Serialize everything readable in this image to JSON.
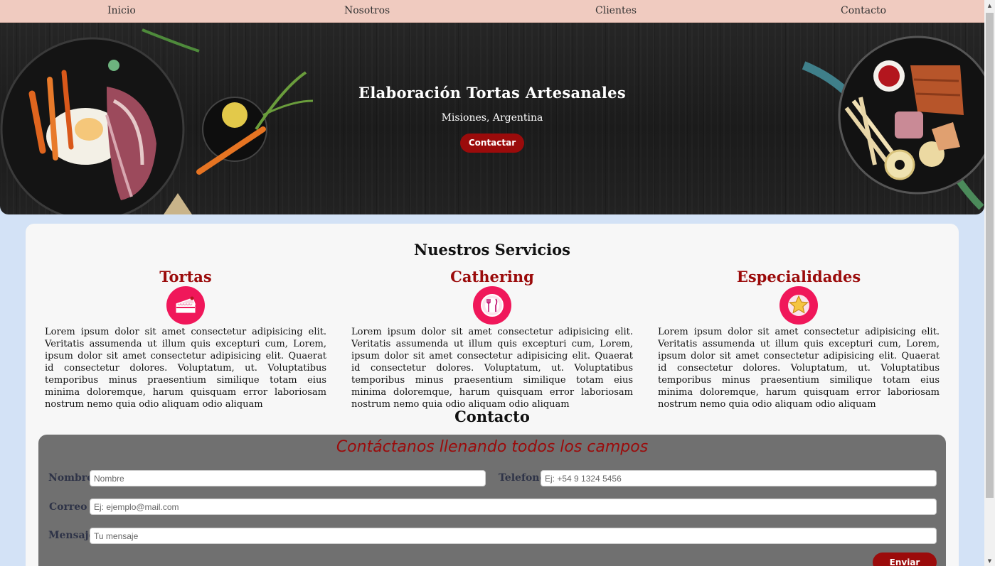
{
  "nav": {
    "items": [
      "Inicio",
      "Nosotros",
      "Clientes",
      "Contacto"
    ]
  },
  "hero": {
    "title": "Elaboración Tortas Artesanales",
    "subtitle": "Misiones, Argentina",
    "button_label": "Contactar"
  },
  "services": {
    "title": "Nuestros Servicios",
    "items": [
      {
        "title": "Tortas",
        "icon": "cake-icon",
        "text": "Lorem ipsum dolor sit amet consectetur adipisicing elit. Veritatis assumenda ut illum quis excepturi cum, Lorem, ipsum dolor sit amet consectetur adipisicing elit. Quaerat id consectetur dolores. Voluptatum, ut. Voluptatibus temporibus minus praesentium similique totam eius minima doloremque, harum quisquam error laboriosam nostrum nemo quia odio aliquam odio aliquam"
      },
      {
        "title": "Cathering",
        "icon": "plate-cutlery-icon",
        "text": "Lorem ipsum dolor sit amet consectetur adipisicing elit. Veritatis assumenda ut illum quis excepturi cum, Lorem, ipsum dolor sit amet consectetur adipisicing elit. Quaerat id consectetur dolores. Voluptatum, ut. Voluptatibus temporibus minus praesentium similique totam eius minima doloremque, harum quisquam error laboriosam nostrum nemo quia odio aliquam odio aliquam"
      },
      {
        "title": "Especialidades",
        "icon": "star-icon",
        "text": "Lorem ipsum dolor sit amet consectetur adipisicing elit. Veritatis assumenda ut illum quis excepturi cum, Lorem, ipsum dolor sit amet consectetur adipisicing elit. Quaerat id consectetur dolores. Voluptatum, ut. Voluptatibus temporibus minus praesentium similique totam eius minima doloremque, harum quisquam error laboriosam nostrum nemo quia odio aliquam odio aliquam"
      }
    ]
  },
  "contact": {
    "title": "Contacto",
    "form_title": "Contáctanos llenando todos los campos",
    "name_label": "Nombre",
    "name_placeholder": "Nombre",
    "phone_label": "Telefono",
    "phone_placeholder": "Ej: +54 9 1324 5456",
    "email_label": "Correo",
    "email_placeholder": "Ej: ejemplo@mail.com",
    "message_label": "Mensaje",
    "message_placeholder": "Tu mensaje",
    "send_label": "Enviar"
  },
  "colors": {
    "accent": "#9b0b0b",
    "icon_bg": "#f0175a",
    "nav_bg": "#f0cbc0",
    "page_bg": "#d3e2f6",
    "form_bg": "#707070"
  }
}
